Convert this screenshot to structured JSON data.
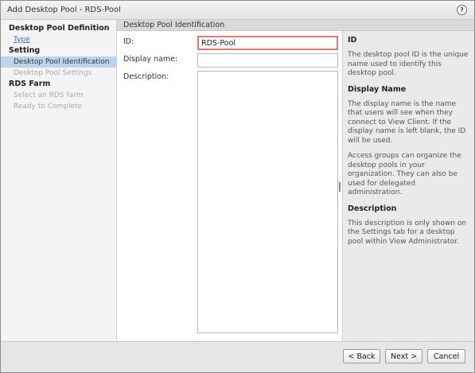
{
  "window": {
    "title": "Add Desktop Pool - RDS-Pool",
    "help_label": "?"
  },
  "sidebar": {
    "sections": [
      {
        "label": "Desktop Pool Definition"
      },
      {
        "label": "Setting"
      },
      {
        "label": "RDS Farm"
      }
    ],
    "items": [
      {
        "label": "Type",
        "state": "link"
      },
      {
        "label": "Desktop Pool Identification",
        "state": "active"
      },
      {
        "label": "Desktop Pool Settings",
        "state": "disabled"
      },
      {
        "label": "Select an RDS farm",
        "state": "disabled"
      },
      {
        "label": "Ready to Complete",
        "state": "disabled"
      }
    ]
  },
  "header": {
    "title": "Desktop Pool Identification"
  },
  "form": {
    "id_label": "ID:",
    "id_value": "RDS-Pool",
    "display_name_label": "Display name:",
    "display_name_value": "",
    "description_label": "Description:",
    "description_value": ""
  },
  "help": {
    "id_heading": "ID",
    "id_text": "The desktop pool ID is the unique name used to identify this desktop pool.",
    "display_heading": "Display Name",
    "display_text": "The display name is the name that users will see when they connect to View Client. If the display name is left blank, the ID will be used.",
    "access_text": "Access groups can organize the desktop pools in your organization. They can also be used for delegated administration.",
    "description_heading": "Description",
    "description_text": "This description is only shown on the Settings tab for a desktop pool within View Administrator."
  },
  "footer": {
    "back_label": "< Back",
    "next_label": "Next >",
    "cancel_label": "Cancel"
  },
  "colors": {
    "active_item_bg": "#bdd3ee",
    "link": "#3a6cc1",
    "focus_border": "#e07a7a"
  }
}
